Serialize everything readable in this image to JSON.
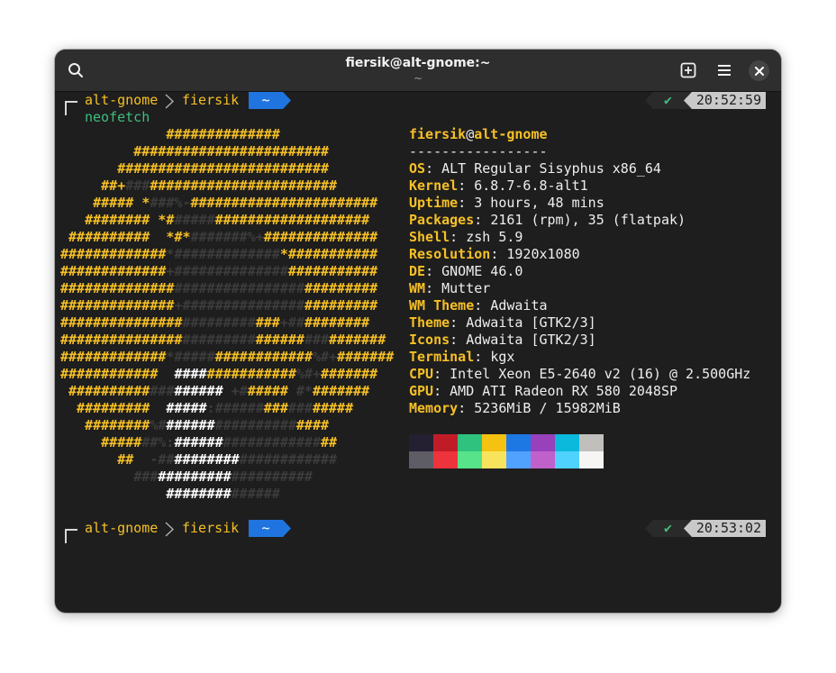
{
  "window": {
    "title": "fiersik@alt-gnome:~",
    "subtitle": "~"
  },
  "header": {
    "search_icon": "search-icon",
    "new_tab_icon": "new-tab-icon",
    "menu_icon": "hamburger-menu-icon",
    "close_icon": "close-icon"
  },
  "prompt1": {
    "host": "alt-gnome",
    "separator": ">",
    "user": "fiersik",
    "dir": "~",
    "status": "✔",
    "time": "20:52:59",
    "command": "neofetch"
  },
  "prompt2": {
    "host": "alt-gnome",
    "separator": ">",
    "user": "fiersik",
    "dir": "~",
    "status": "✔",
    "time": "20:53:02"
  },
  "ascii_logo": [
    [
      [
        "y",
        "             ##############"
      ]
    ],
    [
      [
        "y",
        "         ########################"
      ]
    ],
    [
      [
        "y",
        "       ##########################"
      ]
    ],
    [
      [
        "y",
        "     ##+"
      ],
      [
        "d",
        "###"
      ],
      [
        "y",
        "#######################"
      ]
    ],
    [
      [
        "y",
        "    #####"
      ],
      [
        "d",
        " "
      ],
      [
        "y",
        "*"
      ],
      [
        "d",
        "###%-"
      ],
      [
        "y",
        "#######################"
      ]
    ],
    [
      [
        "y",
        "   ########"
      ],
      [
        "d",
        " "
      ],
      [
        "y",
        "*#"
      ],
      [
        "d",
        "#####"
      ],
      [
        "y",
        "###################"
      ]
    ],
    [
      [
        "y",
        " ##########"
      ],
      [
        "d",
        "  "
      ],
      [
        "y",
        "*#*"
      ],
      [
        "d",
        "#######%+"
      ],
      [
        "y",
        "##############"
      ]
    ],
    [
      [
        "y",
        "#############"
      ],
      [
        "d",
        "*#############"
      ],
      [
        "y",
        "*###########"
      ]
    ],
    [
      [
        "y",
        "#############"
      ],
      [
        "d",
        "+##############"
      ],
      [
        "y",
        "###########"
      ]
    ],
    [
      [
        "y",
        "##############"
      ],
      [
        "d",
        "################"
      ],
      [
        "y",
        "#########"
      ]
    ],
    [
      [
        "y",
        "##############"
      ],
      [
        "d",
        "+###############"
      ],
      [
        "y",
        "#########"
      ]
    ],
    [
      [
        "y",
        "###############"
      ],
      [
        "d",
        "#########"
      ],
      [
        "y",
        "###"
      ],
      [
        "d",
        "+##"
      ],
      [
        "y",
        "########"
      ]
    ],
    [
      [
        "y",
        "###############"
      ],
      [
        "d",
        "#########"
      ],
      [
        "y",
        "######"
      ],
      [
        "d",
        "###"
      ],
      [
        "y",
        "#######"
      ]
    ],
    [
      [
        "y",
        "#############"
      ],
      [
        "d",
        "*#####"
      ],
      [
        "y",
        "############"
      ],
      [
        "d",
        "%#+"
      ],
      [
        "y",
        "#######"
      ]
    ],
    [
      [
        "y",
        "############"
      ],
      [
        "d",
        "  "
      ],
      [
        "w",
        "####"
      ],
      [
        "y",
        "###########"
      ],
      [
        "d",
        "%#+"
      ],
      [
        "y",
        "#######"
      ]
    ],
    [
      [
        "y",
        " ##########"
      ],
      [
        "d",
        "###"
      ],
      [
        "w",
        "######"
      ],
      [
        "d",
        " +#"
      ],
      [
        "y",
        "#####"
      ],
      [
        "d",
        " #*"
      ],
      [
        "y",
        "#######"
      ]
    ],
    [
      [
        "y",
        "  #########"
      ],
      [
        "d",
        "  "
      ],
      [
        "w",
        "#####"
      ],
      [
        "d",
        ":######"
      ],
      [
        "y",
        "###"
      ],
      [
        "d",
        "###"
      ],
      [
        "y",
        "#####"
      ]
    ],
    [
      [
        "y",
        "   ########"
      ],
      [
        "d",
        "%#"
      ],
      [
        "w",
        "######"
      ],
      [
        "d",
        "##########"
      ],
      [
        "y",
        "####"
      ]
    ],
    [
      [
        "y",
        "     #####"
      ],
      [
        "d",
        "##%:"
      ],
      [
        "w",
        "######"
      ],
      [
        "d",
        "############"
      ],
      [
        "y",
        "##"
      ]
    ],
    [
      [
        "y",
        "       ##"
      ],
      [
        "d",
        "  -##"
      ],
      [
        "w",
        "########"
      ],
      [
        "d",
        "############"
      ]
    ],
    [
      [
        "d",
        "         ###"
      ],
      [
        "w",
        "#########"
      ],
      [
        "d",
        "##########"
      ]
    ],
    [
      [
        "d",
        "             "
      ],
      [
        "w",
        "########"
      ],
      [
        "d",
        "######"
      ]
    ]
  ],
  "sysinfo": {
    "user": "fiersik",
    "at": "@",
    "host": "alt-gnome",
    "divider": "-----------------",
    "fields": [
      {
        "label": "OS",
        "value": "ALT Regular Sisyphus x86_64"
      },
      {
        "label": "Kernel",
        "value": "6.8.7-6.8-alt1"
      },
      {
        "label": "Uptime",
        "value": "3 hours, 48 mins"
      },
      {
        "label": "Packages",
        "value": "2161 (rpm), 35 (flatpak)"
      },
      {
        "label": "Shell",
        "value": "zsh 5.9"
      },
      {
        "label": "Resolution",
        "value": "1920x1080"
      },
      {
        "label": "DE",
        "value": "GNOME 46.0"
      },
      {
        "label": "WM",
        "value": "Mutter"
      },
      {
        "label": "WM Theme",
        "value": "Adwaita"
      },
      {
        "label": "Theme",
        "value": "Adwaita [GTK2/3]"
      },
      {
        "label": "Icons",
        "value": "Adwaita [GTK2/3]"
      },
      {
        "label": "Terminal",
        "value": "kgx"
      },
      {
        "label": "CPU",
        "value": "Intel Xeon E5-2640 v2 (16) @ 2.500GHz"
      },
      {
        "label": "GPU",
        "value": "AMD ATI Radeon RX 580 2048SP"
      },
      {
        "label": "Memory",
        "value": "5236MiB / 15982MiB"
      }
    ]
  },
  "palette": {
    "normal": [
      "#241f31",
      "#c01c28",
      "#2ec27e",
      "#f5c211",
      "#1e78e4",
      "#9841bb",
      "#0ab9dc",
      "#c0bfbc"
    ],
    "bright": [
      "#5e5c64",
      "#ed333b",
      "#57e389",
      "#f8e45c",
      "#51a1ff",
      "#c061cb",
      "#4fd2fd",
      "#f6f5f4"
    ]
  }
}
